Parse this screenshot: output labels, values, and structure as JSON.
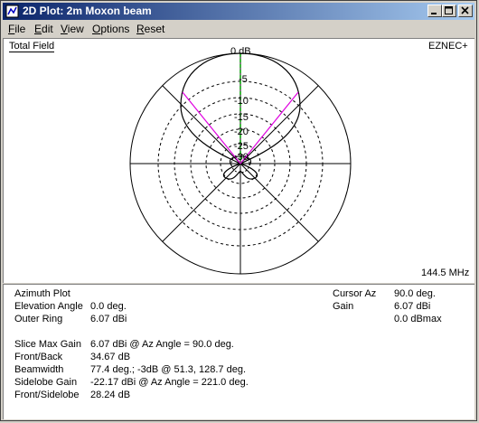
{
  "window": {
    "title": "2D Plot: 2m Moxon beam",
    "icon": "app-plot-icon",
    "controls": [
      "minimize-icon",
      "maximize-icon",
      "close-icon"
    ]
  },
  "menu": [
    "File",
    "Edit",
    "View",
    "Options",
    "Reset"
  ],
  "plot": {
    "field_label": "Total Field",
    "brand": "EZNEC+",
    "frequency": "144.5 MHz",
    "ring_labels": [
      "0 dB",
      "-5",
      "-10",
      "-15",
      "-20",
      "-25",
      "-30"
    ],
    "colors": {
      "pattern": "#000000",
      "cursor": "#00a000",
      "beamwidth": "#e000e0",
      "grid": "#000000"
    }
  },
  "info": {
    "plot_type": "Azimuth Plot",
    "elevation": {
      "label": "Elevation Angle",
      "value": "0.0 deg."
    },
    "outer_ring": {
      "label": "Outer Ring",
      "value": "6.07 dBi"
    },
    "cursor_az": {
      "label": "Cursor Az",
      "value": "90.0 deg."
    },
    "gain": {
      "label": "Gain",
      "value": "6.07 dBi",
      "value2": "0.0 dBmax"
    },
    "slice_max_gain": {
      "label": "Slice Max Gain",
      "value": "6.07 dBi @ Az Angle = 90.0 deg."
    },
    "front_back": {
      "label": "Front/Back",
      "value": "34.67 dB"
    },
    "beamwidth": {
      "label": "Beamwidth",
      "value": "77.4 deg.; -3dB @ 51.3, 128.7 deg."
    },
    "sidelobe_gain": {
      "label": "Sidelobe Gain",
      "value": "-22.17 dBi @ Az Angle = 221.0 deg."
    },
    "front_sidelobe": {
      "label": "Front/Sidelobe",
      "value": "28.24 dB"
    }
  }
}
